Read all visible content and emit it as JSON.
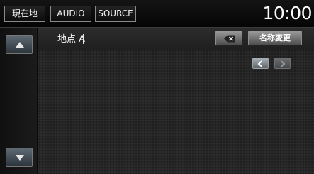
{
  "header": {
    "tabs": [
      {
        "label": "現在地"
      },
      {
        "label": "AUDIO"
      },
      {
        "label": "SOURCE"
      }
    ],
    "clock": "10:00"
  },
  "editor": {
    "name_value": "地点 A",
    "rename_label": "名称変更"
  },
  "icons": {
    "scroll_up": "triangle-up-icon",
    "scroll_down": "triangle-down-icon",
    "backspace": "backspace-x-icon",
    "prev": "chevron-left-icon",
    "next": "chevron-right-icon"
  },
  "colors": {
    "background": "#262626",
    "topbar": "#0a0a0a",
    "scroll_button": "#4a545c",
    "text": "#f4f4f4"
  }
}
